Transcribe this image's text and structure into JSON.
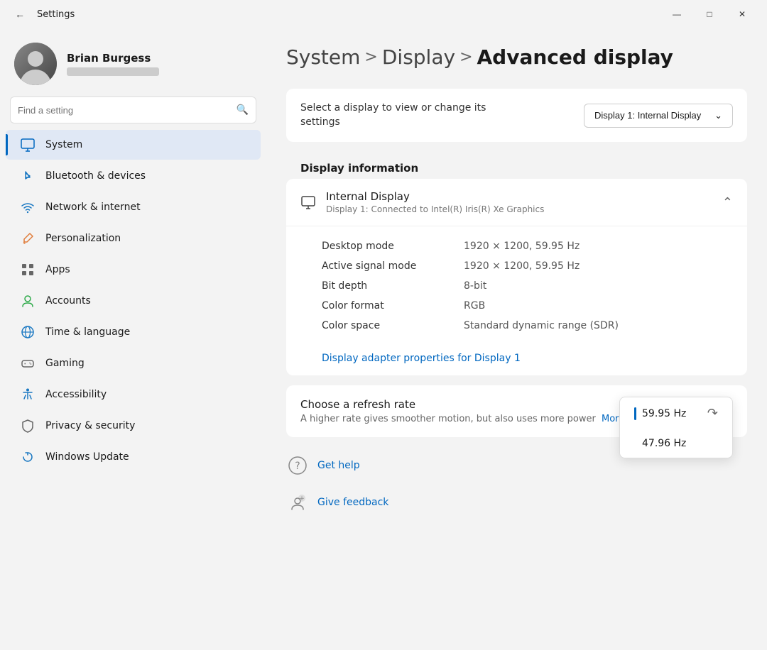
{
  "titlebar": {
    "title": "Settings",
    "minimize": "─",
    "maximize": "□",
    "close": "✕"
  },
  "user": {
    "name": "Brian Burgess",
    "email_placeholder": "email hidden"
  },
  "search": {
    "placeholder": "Find a setting"
  },
  "nav": {
    "items": [
      {
        "id": "system",
        "label": "System",
        "active": true,
        "icon": "monitor"
      },
      {
        "id": "bluetooth",
        "label": "Bluetooth & devices",
        "active": false,
        "icon": "bluetooth"
      },
      {
        "id": "network",
        "label": "Network & internet",
        "active": false,
        "icon": "wifi"
      },
      {
        "id": "personalization",
        "label": "Personalization",
        "active": false,
        "icon": "brush"
      },
      {
        "id": "apps",
        "label": "Apps",
        "active": false,
        "icon": "apps"
      },
      {
        "id": "accounts",
        "label": "Accounts",
        "active": false,
        "icon": "person"
      },
      {
        "id": "time",
        "label": "Time & language",
        "active": false,
        "icon": "globe"
      },
      {
        "id": "gaming",
        "label": "Gaming",
        "active": false,
        "icon": "gaming"
      },
      {
        "id": "accessibility",
        "label": "Accessibility",
        "active": false,
        "icon": "accessibility"
      },
      {
        "id": "privacy",
        "label": "Privacy & security",
        "active": false,
        "icon": "shield"
      },
      {
        "id": "update",
        "label": "Windows Update",
        "active": false,
        "icon": "update"
      }
    ]
  },
  "breadcrumb": {
    "system": "System",
    "sep1": ">",
    "display": "Display",
    "sep2": ">",
    "advanced": "Advanced display"
  },
  "content": {
    "display_selector": {
      "text": "Select a display to view or change its settings",
      "dropdown_label": "Display 1: Internal Display"
    },
    "display_info_section": "Display information",
    "display_info": {
      "name": "Internal Display",
      "subtitle": "Display 1: Connected to Intel(R) Iris(R) Xe Graphics",
      "rows": [
        {
          "label": "Desktop mode",
          "value": "1920 × 1200, 59.95 Hz"
        },
        {
          "label": "Active signal mode",
          "value": "1920 × 1200, 59.95 Hz"
        },
        {
          "label": "Bit depth",
          "value": "8-bit"
        },
        {
          "label": "Color format",
          "value": "RGB"
        },
        {
          "label": "Color space",
          "value": "Standard dynamic range (SDR)"
        }
      ],
      "adapter_link": "Display adapter properties for Display 1"
    },
    "refresh_rate": {
      "label": "Choose a refresh rate",
      "description": "A higher rate gives smoother motion, but also uses more power",
      "more_link": "More about refresh rate",
      "options": [
        {
          "value": "59.95 Hz",
          "selected": true
        },
        {
          "value": "47.96 Hz",
          "selected": false
        }
      ]
    },
    "help": {
      "items": [
        {
          "icon": "help",
          "label": "Get help"
        },
        {
          "icon": "feedback",
          "label": "Give feedback"
        }
      ]
    }
  }
}
